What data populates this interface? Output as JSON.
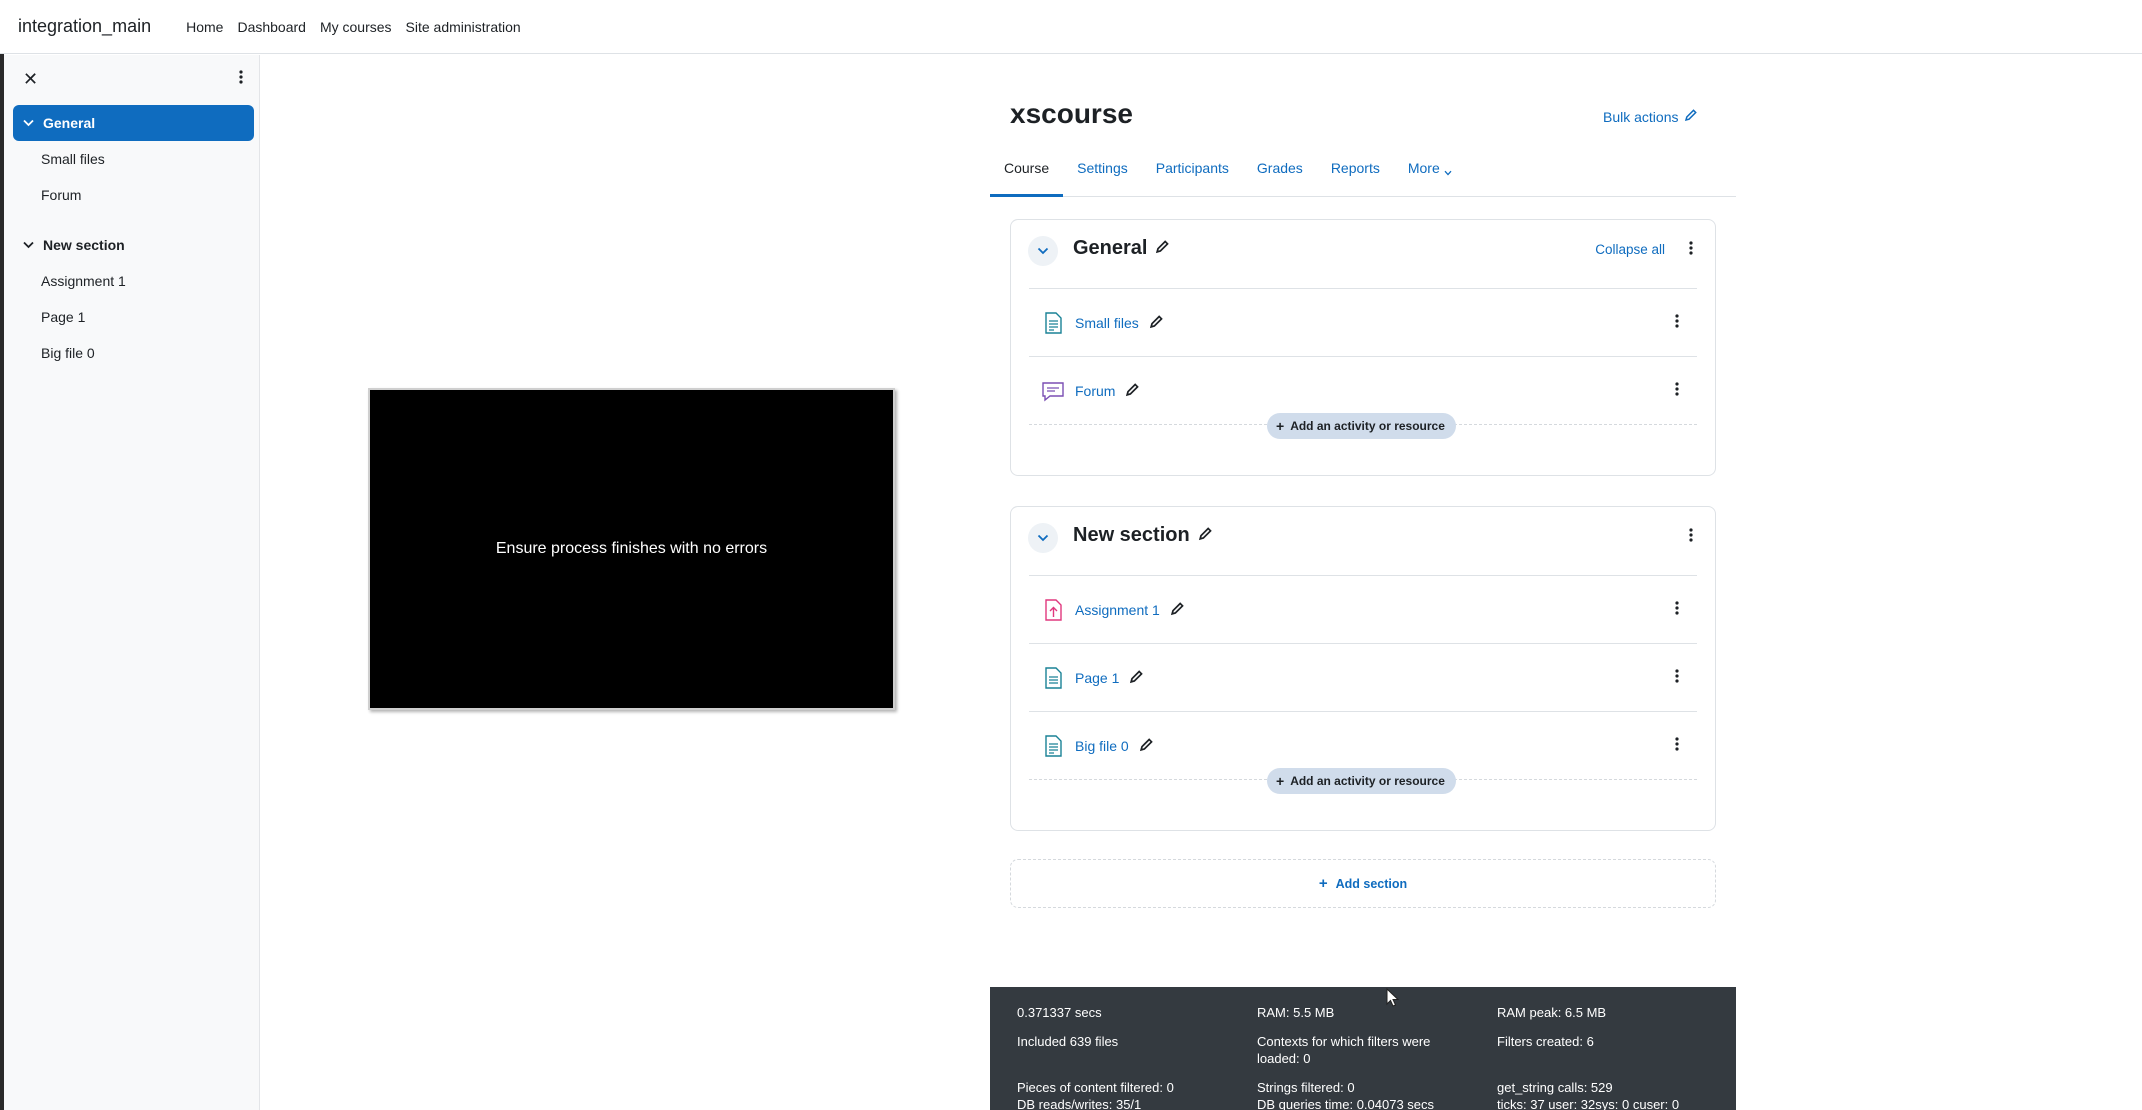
{
  "navbar": {
    "brand": "integration_main",
    "links": [
      "Home",
      "Dashboard",
      "My courses",
      "Site administration"
    ]
  },
  "drawer": {
    "sections": [
      {
        "title": "General",
        "active": true,
        "items": [
          "Small files",
          "Forum"
        ]
      },
      {
        "title": "New section",
        "active": false,
        "items": [
          "Assignment 1",
          "Page 1",
          "Big file 0"
        ]
      }
    ]
  },
  "course": {
    "title": "xscourse",
    "bulk_actions": "Bulk actions",
    "tabs": [
      "Course",
      "Settings",
      "Participants",
      "Grades",
      "Reports",
      "More"
    ],
    "collapse_all": "Collapse all",
    "add_activity": "Add an activity or resource",
    "add_section": "Add section",
    "sections": [
      {
        "title": "General",
        "activities": [
          {
            "name": "Small files",
            "icon": "resource-icon",
            "color": "#1a8296"
          },
          {
            "name": "Forum",
            "icon": "forum-icon",
            "color": "#7b4fb4"
          }
        ]
      },
      {
        "title": "New section",
        "activities": [
          {
            "name": "Assignment 1",
            "icon": "assignment-icon",
            "color": "#e0387e"
          },
          {
            "name": "Page 1",
            "icon": "page-icon",
            "color": "#1a8296"
          },
          {
            "name": "Big file 0",
            "icon": "resource-icon",
            "color": "#1a8296"
          }
        ]
      }
    ]
  },
  "video": {
    "caption": "Ensure process finishes with no errors"
  },
  "perf": {
    "col1": [
      "0.371337 secs",
      "Included 639 files",
      "Pieces of content filtered: 0",
      "DB reads/writes: 35/1"
    ],
    "col2": [
      "RAM: 5.5 MB",
      "Contexts for which filters were loaded: 0",
      "Strings filtered: 0",
      "DB queries time: 0.04073 secs"
    ],
    "col3": [
      "RAM peak: 6.5 MB",
      "Filters created: 6",
      "get_string calls: 529",
      "ticks: 37 user: 32sys: 0 cuser: 0"
    ]
  },
  "colors": {
    "primary": "#0f6cbf",
    "footer": "#343a40"
  }
}
